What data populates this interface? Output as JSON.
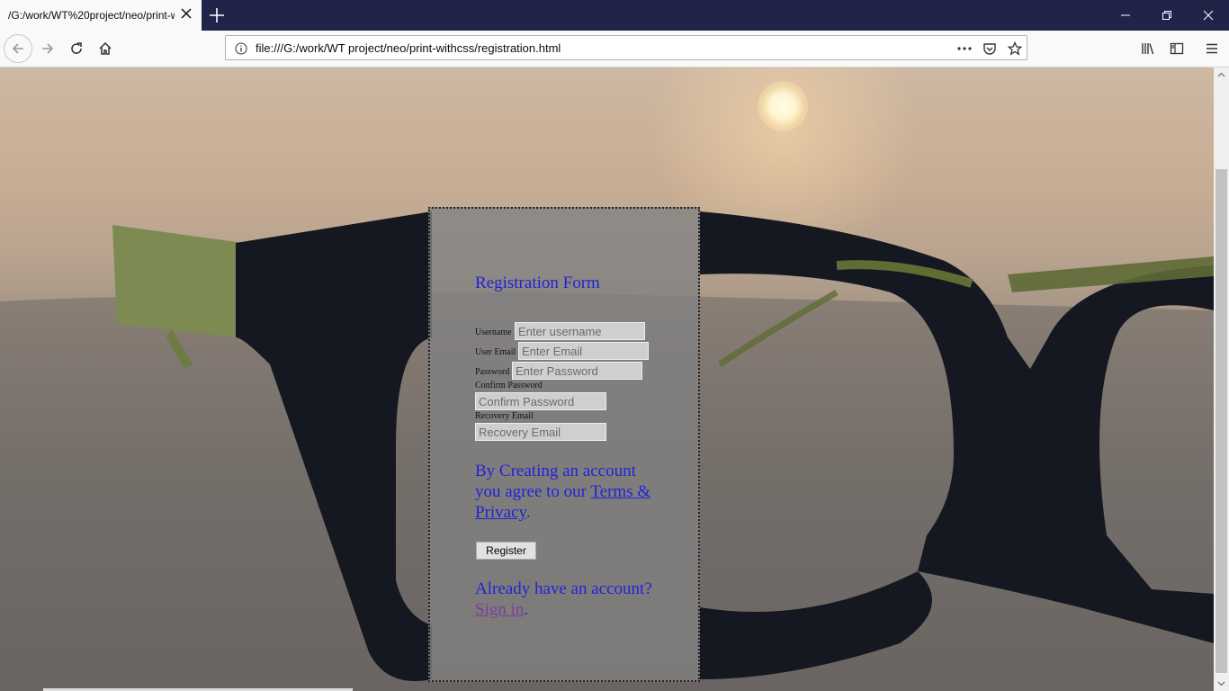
{
  "browser": {
    "tab_title": "/G:/work/WT%20project/neo/print-withcss/registration.html",
    "url": "file:///G:/work/WT project/neo/print-withcss/registration.html"
  },
  "icons": [
    "back-arrow-icon",
    "forward-arrow-icon",
    "reload-icon",
    "home-icon",
    "info-icon",
    "more-dots-icon",
    "pocket-icon",
    "bookmark-star-icon",
    "library-icon",
    "sidebar-icon",
    "menu-icon"
  ],
  "form": {
    "title": "Registration Form",
    "username_label": "Username",
    "username_placeholder": "Enter username",
    "email_label": "User Email",
    "email_placeholder": "Enter Email",
    "password_label": "Password",
    "password_placeholder": "Enter Password",
    "confirm_label": "Confirm Password",
    "confirm_placeholder": "Confirm Password",
    "recovery_label": "Recovery Email",
    "recovery_placeholder": "Recovery Email",
    "terms_prefix": "By Creating an account you agree to our ",
    "terms_link": "Terms & Privacy",
    "terms_suffix": ".",
    "register_label": "Register",
    "signin_prefix": "Already have an account?",
    "signin_link": "Sign in",
    "signin_suffix": "."
  }
}
